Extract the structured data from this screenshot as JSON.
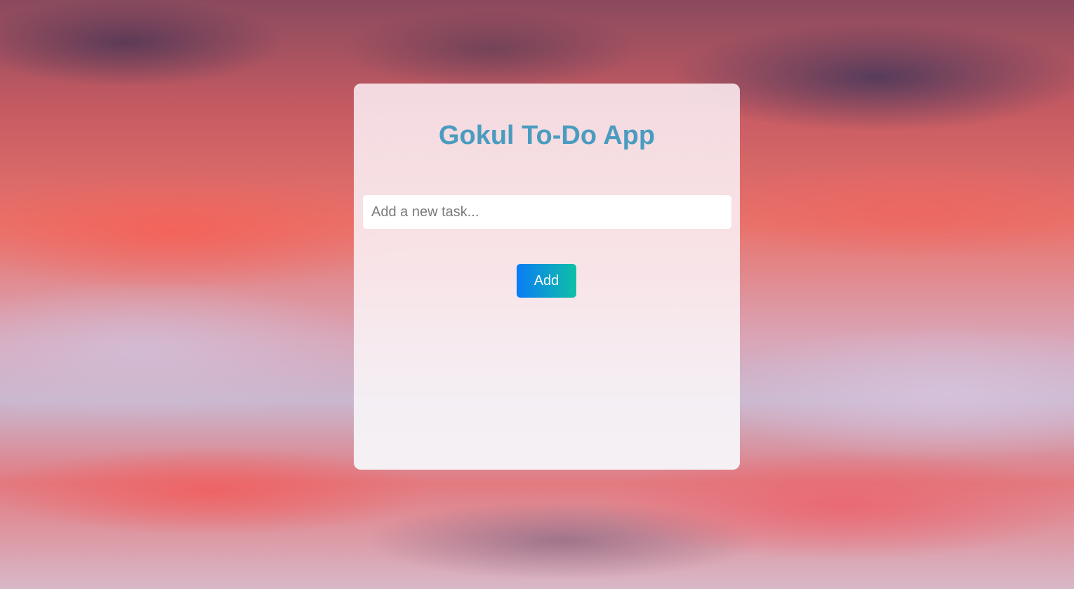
{
  "app": {
    "title": "Gokul To-Do App"
  },
  "task_form": {
    "input_value": "",
    "input_placeholder": "Add a new task...",
    "add_label": "Add"
  },
  "tasks": [],
  "colors": {
    "title": "#4a9cbf",
    "button_gradient_start": "#0a7cf5",
    "button_gradient_end": "#0fc0a6",
    "button_text": "#ffffff"
  }
}
